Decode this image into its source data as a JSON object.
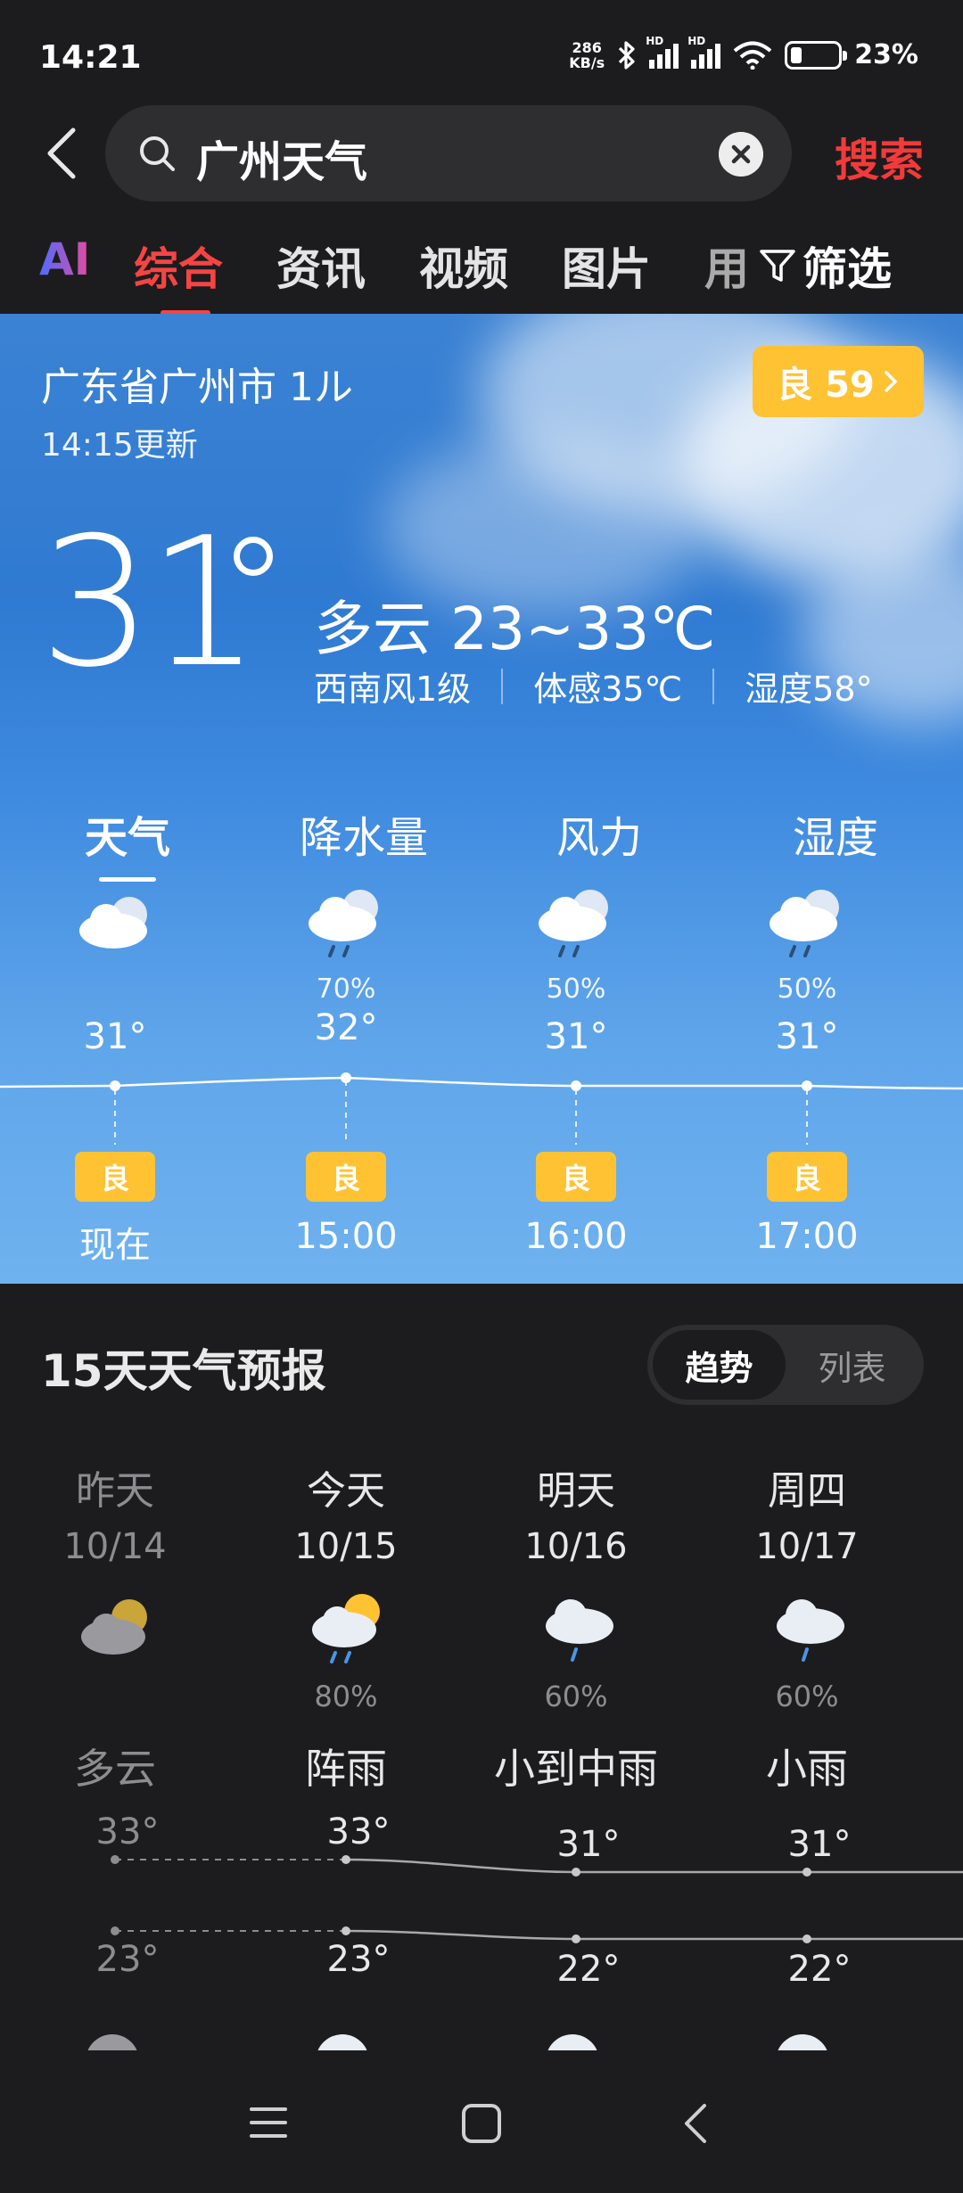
{
  "status": {
    "time": "14:21",
    "net_speed_top": "286",
    "net_speed_bottom": "KB/s",
    "hd1": "HD",
    "hd2": "HD",
    "battery": "23%",
    "battery_level": 0.23
  },
  "search": {
    "query": "广州天气",
    "button": "搜索"
  },
  "tabs": {
    "ai": "AI",
    "items": [
      "综合",
      "资讯",
      "视频",
      "图片"
    ],
    "more": "用",
    "filter": "筛选"
  },
  "weather": {
    "location": "广东省广州市 1ル",
    "updated": "14:15更新",
    "aqi": "良 59",
    "temp": "31",
    "condition": "多云  23~33℃",
    "wind": "西南风1级",
    "feels": "体感35℃",
    "humidity": "湿度58°"
  },
  "hourly_tabs": [
    "天气",
    "降水量",
    "风力",
    "湿度"
  ],
  "hourly": [
    {
      "icon": "cloudy-icon",
      "pct": "",
      "temp": "31°",
      "aq": "良",
      "time": "现在"
    },
    {
      "icon": "rain-icon",
      "pct": "70%",
      "temp": "32°",
      "aq": "良",
      "time": "15:00"
    },
    {
      "icon": "rain-icon",
      "pct": "50%",
      "temp": "31°",
      "aq": "良",
      "time": "16:00"
    },
    {
      "icon": "rain-icon",
      "pct": "50%",
      "temp": "31°",
      "aq": "良",
      "time": "17:00"
    }
  ],
  "forecast": {
    "title": "15天天气预报",
    "toggle": [
      "趋势",
      "列表"
    ],
    "days": [
      {
        "name": "昨天",
        "date": "10/14",
        "icon": "partly-cloudy-icon",
        "pct": "",
        "cond": "多云",
        "high": "33°",
        "low": "23°"
      },
      {
        "name": "今天",
        "date": "10/15",
        "icon": "sun-shower-icon",
        "pct": "80%",
        "cond": "阵雨",
        "high": "33°",
        "low": "23°"
      },
      {
        "name": "明天",
        "date": "10/16",
        "icon": "light-rain-icon",
        "pct": "60%",
        "cond": "小到中雨",
        "high": "31°",
        "low": "22°"
      },
      {
        "name": "周四",
        "date": "10/17",
        "icon": "light-rain-icon",
        "pct": "60%",
        "cond": "小雨",
        "high": "31°",
        "low": "22°"
      }
    ]
  },
  "colors": {
    "accent": "#f64444",
    "aqi": "#ffc233",
    "card_top": "#3b82d3",
    "card_bottom": "#6fb2ef"
  }
}
